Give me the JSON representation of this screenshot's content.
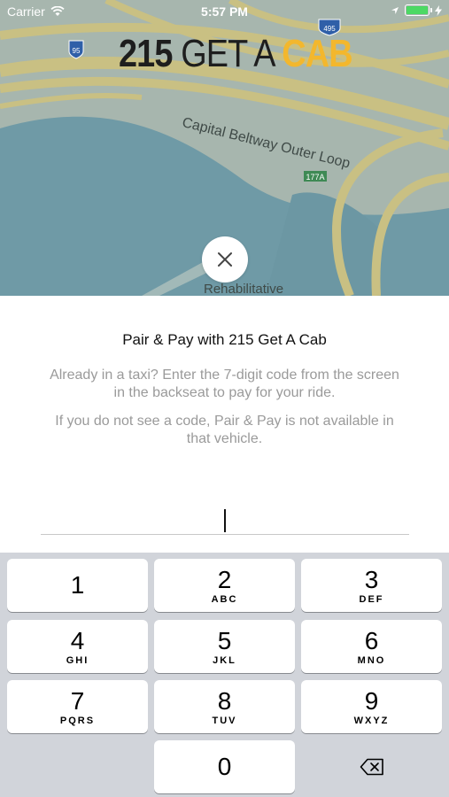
{
  "status_bar": {
    "carrier": "Carrier",
    "time": "5:57 PM"
  },
  "map": {
    "logo": {
      "number": "215",
      "middle": " GET A ",
      "cab": "CAB"
    },
    "road_label": "Capital Beltway Outer Loop",
    "place_label": "Rehabilitative",
    "shield_labels": {
      "interstate_95": "95",
      "interstate_495": "495",
      "exit": "177A"
    }
  },
  "close_button": {
    "icon": "close-icon"
  },
  "pair_pay": {
    "title": "Pair & Pay with 215 Get A Cab",
    "description": "Already in a taxi? Enter the 7-digit code from the screen in the backseat to pay for your ride.",
    "note": "If you do not see a code, Pair & Pay is not available in that vehicle.",
    "code_value": ""
  },
  "keypad": {
    "keys": [
      {
        "digit": "1",
        "letters": ""
      },
      {
        "digit": "2",
        "letters": "ABC"
      },
      {
        "digit": "3",
        "letters": "DEF"
      },
      {
        "digit": "4",
        "letters": "GHI"
      },
      {
        "digit": "5",
        "letters": "JKL"
      },
      {
        "digit": "6",
        "letters": "MNO"
      },
      {
        "digit": "7",
        "letters": "PQRS"
      },
      {
        "digit": "8",
        "letters": "TUV"
      },
      {
        "digit": "9",
        "letters": "WXYZ"
      },
      {
        "digit": "0",
        "letters": ""
      }
    ],
    "delete_icon": "backspace-icon"
  },
  "colors": {
    "brand_yellow": "#f3b72d",
    "map_road": "#c9c083",
    "map_water": "#6f9aa6",
    "keypad_bg": "#d1d4da"
  }
}
